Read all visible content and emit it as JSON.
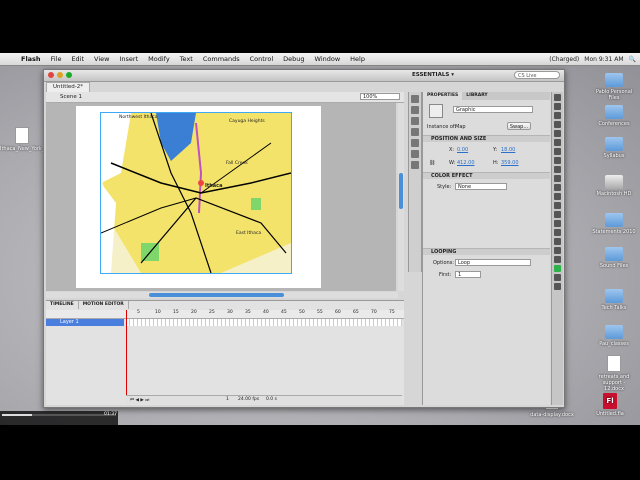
{
  "menubar": {
    "apple": "",
    "items": [
      "Flash",
      "File",
      "Edit",
      "View",
      "Insert",
      "Modify",
      "Text",
      "Commands",
      "Control",
      "Debug",
      "Window",
      "Help"
    ],
    "status": {
      "battery": "(Charged)",
      "clock": "Mon 9:31 AM",
      "spotlight": "🔍"
    }
  },
  "window": {
    "workspace": "ESSENTIALS ▾",
    "search_placeholder": "CS Live",
    "doc_tab": "Untitled-2*",
    "scene": "Scene 1",
    "zoom": "100%"
  },
  "timeline": {
    "tabs": [
      "TIMELINE",
      "MOTION EDITOR"
    ],
    "frame_numbers": [
      "5",
      "10",
      "15",
      "20",
      "25",
      "30",
      "35",
      "40",
      "45",
      "50",
      "55",
      "60",
      "65",
      "70",
      "75"
    ],
    "layer_name": "Layer 1",
    "footer": {
      "frame": "1",
      "fps": "24.00 fps",
      "time": "0.0 s"
    }
  },
  "properties": {
    "tabs": [
      "PROPERTIES",
      "LIBRARY"
    ],
    "symbol_type": "Graphic",
    "instance_of_label": "Instance of:",
    "instance_of_value": "Map",
    "swap_label": "Swap...",
    "position_section": "POSITION AND SIZE",
    "x_label": "X:",
    "x_value": "0.00",
    "y_label": "Y:",
    "y_value": "18.00",
    "w_label": "W:",
    "w_value": "412.00",
    "h_label": "H:",
    "h_value": "359.00",
    "color_section": "COLOR EFFECT",
    "style_label": "Style:",
    "style_value": "None",
    "looping_section": "LOOPING",
    "options_label": "Options:",
    "options_value": "Loop",
    "first_label": "First:",
    "first_value": "1"
  },
  "map": {
    "labels": [
      "Northwest Ithaca",
      "Cayuga Heights",
      "Fall Creek",
      "Ithaca",
      "East Ithaca"
    ]
  },
  "desktop": {
    "left_icon": "Ithaca_New_York_map_2.gif",
    "right_icons": [
      "Pablo Personal Files",
      "Conferences",
      "Syllabus",
      "Macintosh HD",
      "Statements 2010",
      "Sound Files",
      "Tech Talks",
      "Pau_classes",
      "retreats and support - 12.docx",
      "data-display.docx",
      "Untitled.fla"
    ]
  },
  "video": {
    "time": "01:37"
  }
}
